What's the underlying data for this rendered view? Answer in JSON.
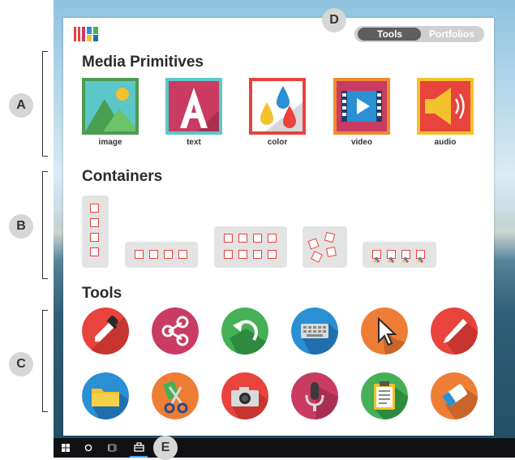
{
  "app": {
    "logo": "app-logo-icon"
  },
  "header": {
    "toggle": {
      "tools_label": "Tools",
      "portfolios_label": "Portfolios",
      "active": "Tools"
    }
  },
  "media": {
    "title": "Media Primitives",
    "items": [
      {
        "label": "image",
        "icon": "image-icon",
        "frame_color": "#56c3c7"
      },
      {
        "label": "text",
        "icon": "text-icon",
        "frame_color": "#5bc7c8"
      },
      {
        "label": "color",
        "icon": "color-drops-icon",
        "frame_color": "#e8433d"
      },
      {
        "label": "video",
        "icon": "video-icon",
        "frame_color": "#ee8a34"
      },
      {
        "label": "audio",
        "icon": "speaker-icon",
        "frame_color": "#f3c22c"
      }
    ]
  },
  "containers": {
    "title": "Containers",
    "items": [
      {
        "name": "vertical-list",
        "cells": 4
      },
      {
        "name": "horizontal-list",
        "cells": 4
      },
      {
        "name": "grid",
        "cells": 8
      },
      {
        "name": "freeform",
        "cells": 4
      },
      {
        "name": "media-list",
        "cells": 4
      }
    ]
  },
  "tools": {
    "title": "Tools",
    "items": [
      {
        "icon": "eyedropper-icon",
        "color": "#e8433d"
      },
      {
        "icon": "share-icon",
        "color": "#c93b62"
      },
      {
        "icon": "undo-icon",
        "color": "#45b056"
      },
      {
        "icon": "keyboard-icon",
        "color": "#2a8fd3"
      },
      {
        "icon": "cursor-icon",
        "color": "#ee7d36"
      },
      {
        "icon": "pen-icon",
        "color": "#e8433d"
      },
      {
        "icon": "folder-icon",
        "color": "#2a8fd3"
      },
      {
        "icon": "scissors-icon",
        "color": "#ee7d36"
      },
      {
        "icon": "camera-icon",
        "color": "#e8433d"
      },
      {
        "icon": "microphone-icon",
        "color": "#c93b62"
      },
      {
        "icon": "clipboard-icon",
        "color": "#45b056"
      },
      {
        "icon": "eraser-icon",
        "color": "#ee7d36"
      }
    ]
  },
  "markers": {
    "a": "A",
    "b": "B",
    "c": "C",
    "d": "D",
    "e": "E"
  },
  "taskbar": {
    "items": [
      "windows-icon",
      "search-circle-icon",
      "task-view-icon",
      "toolbox-icon"
    ]
  }
}
